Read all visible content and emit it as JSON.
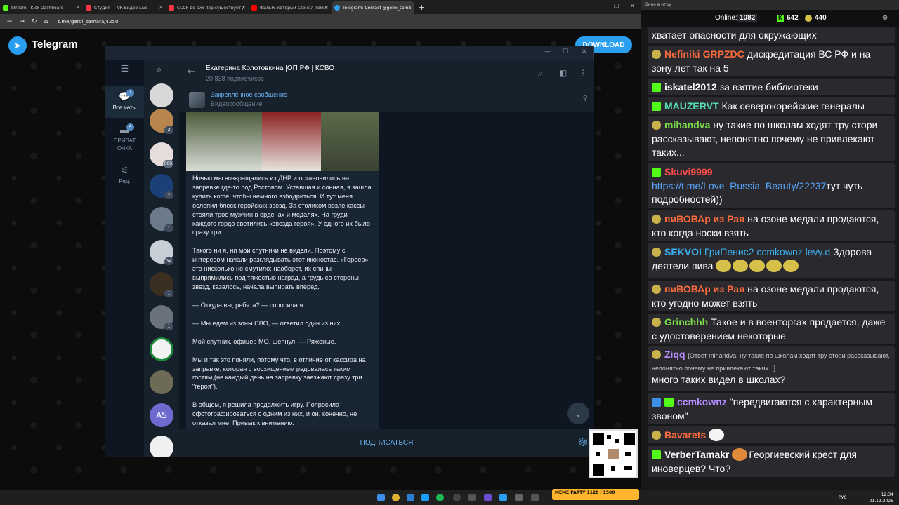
{
  "browser": {
    "tabs": [
      {
        "title": "Stream - Kick Dashboard",
        "color": "#53fc18"
      },
      {
        "title": "Студия — VK Видео Live",
        "color": "#ff3347"
      },
      {
        "title": "СССР до сих пор существует /",
        "color": "#ff3347"
      },
      {
        "title": "Фильм, который сломал Томм",
        "color": "#ff0000"
      },
      {
        "title": "Telegram: Contact @geroi_sama",
        "color": "#2a9ff0"
      }
    ],
    "new_tab": "+",
    "url": "t.me/geroi_samara/4250"
  },
  "tg_page": {
    "brand": "Telegram",
    "download_label": "DOWNLOAD",
    "left_nav": [
      {
        "label": "Все чаты",
        "badge": "7"
      },
      {
        "label": "ПРИВАТ ОЧКА",
        "badge": "4"
      },
      {
        "label": "Ред.",
        "badge": ""
      }
    ],
    "chat_badges": [
      "2",
      "606",
      "2",
      "1",
      "34",
      "1",
      "1"
    ],
    "chat_initials": "AS",
    "channel_title": "Екатерина Колотовкина |ОП РФ | КСВО",
    "channel_subs": "20 838 подписчиков",
    "pinned_label": "Закреплённое сообщение",
    "pinned_sub": "Видеосообщение",
    "message_paragraphs": [
      "Ночью мы возвращались из ДНР и остановились на заправке где-то под Ростовом. Уставшая и сонная, я зашла купить кофе, чтобы немного взбодриться. И тут меня ослепил блеск геройских звезд. За столиком возле кассы стояли трое мужчин в орденах и медалях. На груди каждого гордо светились «звезда героя». У одного их было сразу три.",
      "Такого ни я, ни мои спутники не видели. Поэтому с интересом начали разглядывать этот иконостас. «Героев» это нисколько не смутило; наоборот, их спины выпрямились под тяжестью наград, а грудь со стороны звезд, казалось, начала выпирать вперед.",
      "— Откуда вы, ребята? — спросила я.",
      "— Мы едем из зоны СВО, — ответил один из них.",
      "Мой спутник, офицер МО, шепнул: — Ряженые.",
      "Мы и так это поняли, потому что, в отличие от кассира на заправке, которая с восхищением радовалась таким гостям,(не каждый день на заправку заезжают сразу три \"героя\").",
      "В общем, я решила продолжить игру. Попросила сфотографироваться с одним из них, и он, конечно, не отказал мне. Привык к вниманию."
    ],
    "subscribe_label": "ПОДПИСАТЬСЯ"
  },
  "chat_overlay": {
    "window_title": "Окно в игру",
    "online_label": "Online:",
    "online_count": "1082",
    "kick_count": "642",
    "sub_count": "440",
    "messages": [
      {
        "user": "",
        "text": "хватает опасности для окружающих"
      },
      {
        "user": "Nefiniki",
        "user2": "GRPZDC",
        "text": "дискредитация ВС РФ и на зону лет так на 5",
        "color": "#ff6b3d"
      },
      {
        "user": "iskatel2012",
        "text": "за взятие библиотеки",
        "color": "#ffffff"
      },
      {
        "user": "MAUZERVT",
        "text": "Как северокорейские генералы",
        "color": "#55e0b5"
      },
      {
        "user": "mihandva",
        "text": "ну такие по школам ходят тру стори рассказывают, непонятно почему не привлекают таких...",
        "color": "#7ddc4a"
      },
      {
        "user": "Skuvi9999",
        "link": "https://t.me/Love_Russia_Beauty/22237",
        "text": "тут чуть подробностей))",
        "color": "#ff4b4b"
      },
      {
        "user": "пиВОВАр из Рая",
        "text": "на озоне медали продаются, кто когда носки взять",
        "color": "#ff6b3d"
      },
      {
        "user": "SEKVOI",
        "user2": "ГриПенис2 ccmkownz levy.d",
        "text": "Здорова деятели пива",
        "color": "#3ab0f0"
      },
      {
        "user": "пиВОВАр из Рая",
        "text": "на озоне медали продаются, кто угодно может взять",
        "color": "#ff6b3d"
      },
      {
        "user": "Grinchhh",
        "text": "Такое и в военторгах продается, даже с удостоверением некоторые",
        "color": "#7ddc4a"
      },
      {
        "user": "Ziqq",
        "reply": "[Ответ mihandva: ну такие по школам ходят тру стори рассказывают, непонятно почему не привлекают таких...]",
        "text": "много таких видел в школах?",
        "color": "#b48cff"
      },
      {
        "user": "ccmkownz",
        "text": "\"передвигаются с характерным звоном\"",
        "color": "#b48cff"
      },
      {
        "user": "Bavarets",
        "text": "",
        "color": "#ff6b3d"
      },
      {
        "user": "VerberTamakr",
        "text": "Георгиевский крест для иноверцев? Что?",
        "color": "#ffffff"
      }
    ]
  },
  "taskbar": {
    "lang": "РУС",
    "time": "12:34",
    "date": "21.12.2025",
    "meme_party": "MEME PARTY",
    "meme_progress": "1128 / 1500"
  }
}
